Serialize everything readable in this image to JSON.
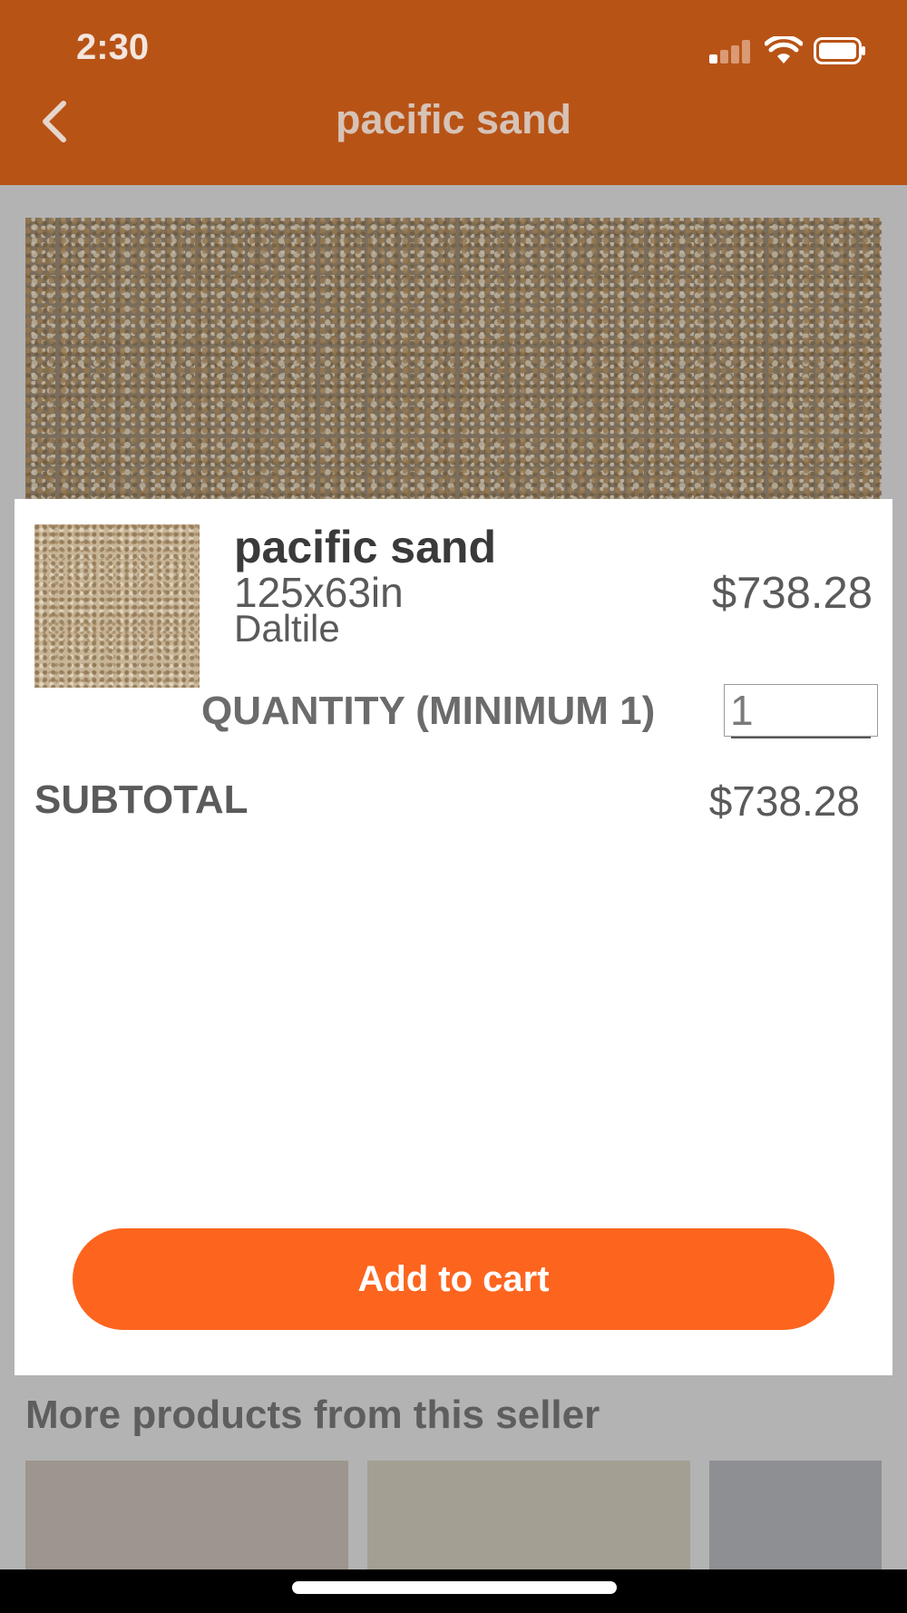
{
  "status_bar": {
    "time": "2:30"
  },
  "nav": {
    "title": "pacific sand",
    "back_icon": "chevron-left-icon"
  },
  "modal": {
    "product_name": "pacific sand",
    "product_size": "125x63in",
    "product_brand": "Daltile",
    "price": "$738.28",
    "quantity_label": "QUANTITY (MINIMUM 1)",
    "quantity_value": "1",
    "subtotal_label": "SUBTOTAL",
    "subtotal_value": "$738.28",
    "add_to_cart_label": "Add to cart"
  },
  "more_products": {
    "title": "More products from this seller",
    "items": [
      {
        "color": "#9c968e"
      },
      {
        "color": "#a39f93"
      },
      {
        "color": "#8e8f92"
      }
    ]
  },
  "colors": {
    "header": "#b85316",
    "accent": "#fd651f",
    "dim_overlay": "#b3b3b3"
  }
}
